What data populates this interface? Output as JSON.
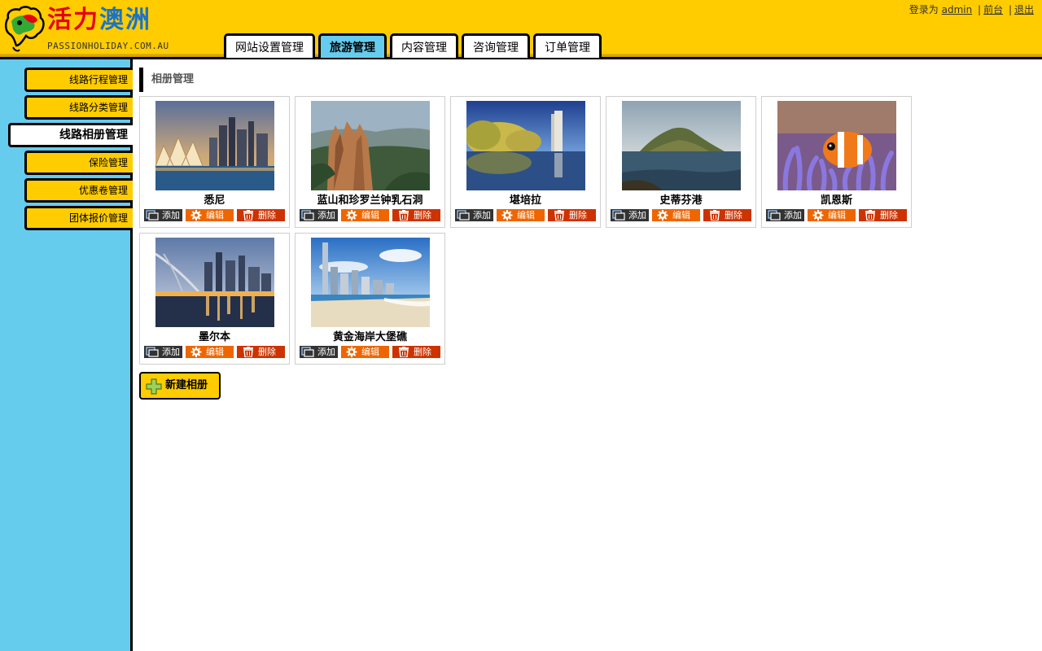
{
  "header": {
    "logo_text": "PASSIONHOLIDAY.COM.AU",
    "logo_chars": [
      "活",
      "力",
      "澳",
      "洲"
    ],
    "nav_tabs": [
      {
        "label": "网站设置管理",
        "active": false
      },
      {
        "label": "旅游管理",
        "active": true
      },
      {
        "label": "内容管理",
        "active": false
      },
      {
        "label": "咨询管理",
        "active": false
      },
      {
        "label": "订单管理",
        "active": false
      }
    ],
    "user": {
      "prefix": "登录为",
      "username": "admin",
      "front_link": "前台",
      "logout_link": "退出",
      "separator": "|"
    }
  },
  "sidebar": {
    "items": [
      {
        "label": "线路行程管理",
        "active": false
      },
      {
        "label": "线路分类管理",
        "active": false
      },
      {
        "label": "线路相册管理",
        "active": true
      },
      {
        "label": "保险管理",
        "active": false
      },
      {
        "label": "优惠卷管理",
        "active": false
      },
      {
        "label": "团体报价管理",
        "active": false
      }
    ]
  },
  "main": {
    "section_title": "相册管理",
    "actions": {
      "add": "添加",
      "edit": "编辑",
      "delete": "删除"
    },
    "albums": [
      {
        "name": "悉尼",
        "photo": "sydney-opera-house"
      },
      {
        "name": "蓝山和珍罗兰钟乳石洞",
        "photo": "blue-mountains-three-sisters"
      },
      {
        "name": "堪培拉",
        "photo": "canberra-lake"
      },
      {
        "name": "史蒂芬港",
        "photo": "port-stephens-island"
      },
      {
        "name": "凯恩斯",
        "photo": "cairns-clownfish"
      },
      {
        "name": "墨尔本",
        "photo": "melbourne-skyline"
      },
      {
        "name": "黄金海岸大堡礁",
        "photo": "gold-coast-beach"
      }
    ],
    "new_album_label": "新建相册"
  },
  "colors": {
    "header_bg": "#ffcc00",
    "sidebar_bg": "#66ccee",
    "active_tab": "#66ccee",
    "btn_add": "#333333",
    "btn_edit": "#ee6600",
    "btn_delete": "#cc3300"
  }
}
